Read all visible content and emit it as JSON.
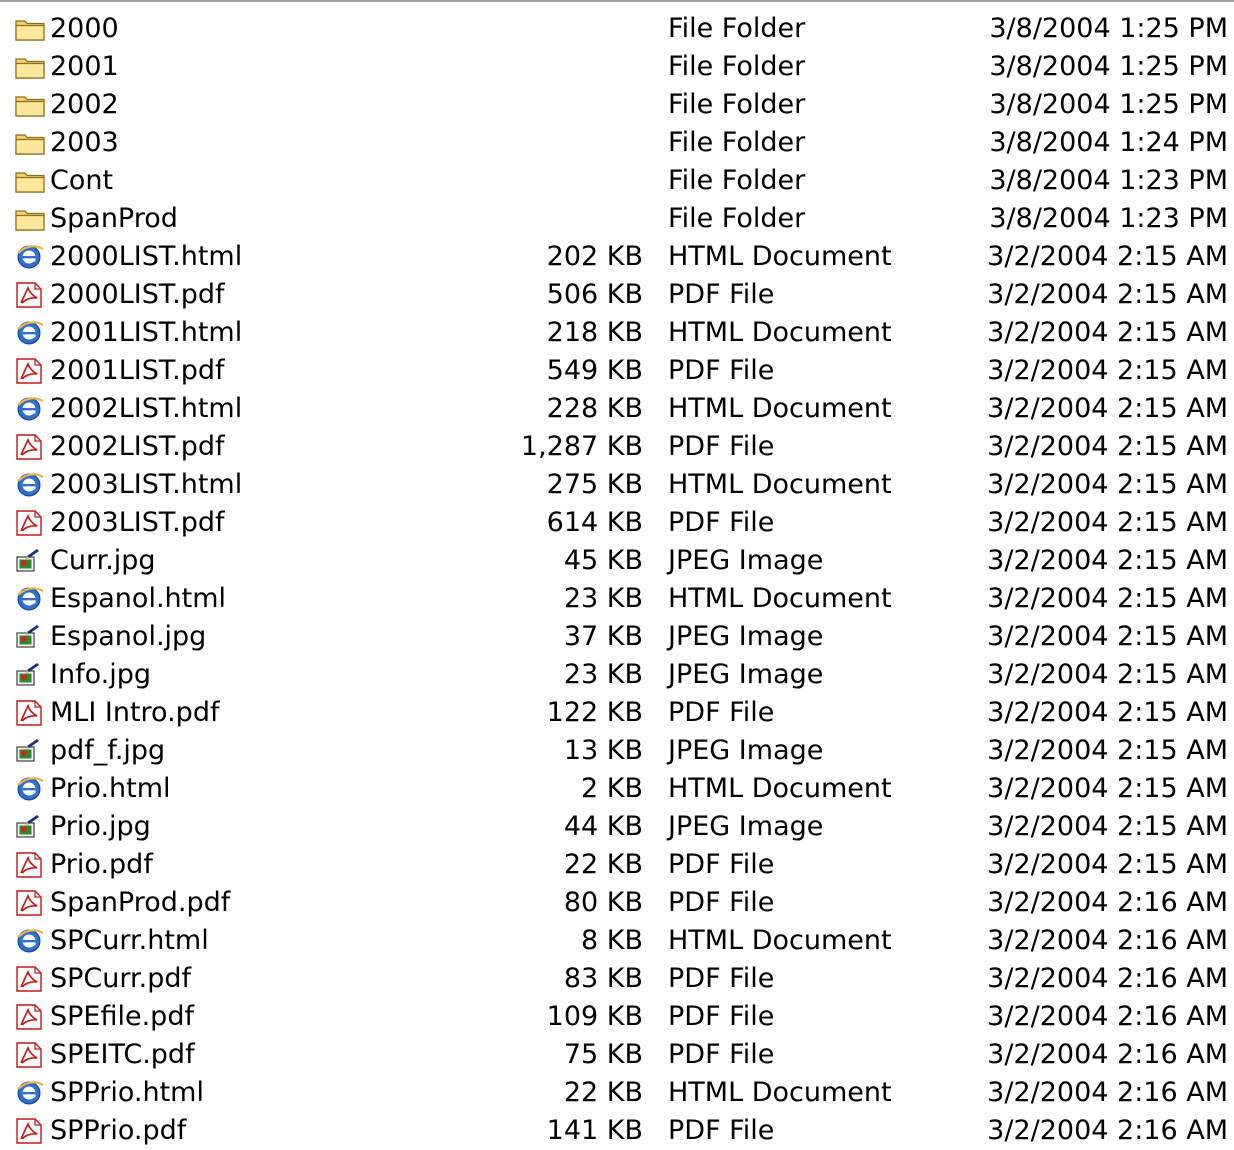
{
  "files": [
    {
      "name": "2000",
      "size": "",
      "type": "File Folder",
      "modified": "3/8/2004 1:25 PM",
      "icon": "folder-icon"
    },
    {
      "name": "2001",
      "size": "",
      "type": "File Folder",
      "modified": "3/8/2004 1:25 PM",
      "icon": "folder-icon"
    },
    {
      "name": "2002",
      "size": "",
      "type": "File Folder",
      "modified": "3/8/2004 1:25 PM",
      "icon": "folder-icon"
    },
    {
      "name": "2003",
      "size": "",
      "type": "File Folder",
      "modified": "3/8/2004 1:24 PM",
      "icon": "folder-icon"
    },
    {
      "name": "Cont",
      "size": "",
      "type": "File Folder",
      "modified": "3/8/2004 1:23 PM",
      "icon": "folder-icon"
    },
    {
      "name": "SpanProd",
      "size": "",
      "type": "File Folder",
      "modified": "3/8/2004 1:23 PM",
      "icon": "folder-icon"
    },
    {
      "name": "2000LIST.html",
      "size": "202 KB",
      "type": "HTML Document",
      "modified": "3/2/2004 2:15 AM",
      "icon": "html-document-icon"
    },
    {
      "name": "2000LIST.pdf",
      "size": "506 KB",
      "type": "PDF File",
      "modified": "3/2/2004 2:15 AM",
      "icon": "pdf-file-icon"
    },
    {
      "name": "2001LIST.html",
      "size": "218 KB",
      "type": "HTML Document",
      "modified": "3/2/2004 2:15 AM",
      "icon": "html-document-icon"
    },
    {
      "name": "2001LIST.pdf",
      "size": "549 KB",
      "type": "PDF File",
      "modified": "3/2/2004 2:15 AM",
      "icon": "pdf-file-icon"
    },
    {
      "name": "2002LIST.html",
      "size": "228 KB",
      "type": "HTML Document",
      "modified": "3/2/2004 2:15 AM",
      "icon": "html-document-icon"
    },
    {
      "name": "2002LIST.pdf",
      "size": "1,287 KB",
      "type": "PDF File",
      "modified": "3/2/2004 2:15 AM",
      "icon": "pdf-file-icon"
    },
    {
      "name": "2003LIST.html",
      "size": "275 KB",
      "type": "HTML Document",
      "modified": "3/2/2004 2:15 AM",
      "icon": "html-document-icon"
    },
    {
      "name": "2003LIST.pdf",
      "size": "614 KB",
      "type": "PDF File",
      "modified": "3/2/2004 2:15 AM",
      "icon": "pdf-file-icon"
    },
    {
      "name": "Curr.jpg",
      "size": "45 KB",
      "type": "JPEG Image",
      "modified": "3/2/2004 2:15 AM",
      "icon": "jpeg-image-icon"
    },
    {
      "name": "Espanol.html",
      "size": "23 KB",
      "type": "HTML Document",
      "modified": "3/2/2004 2:15 AM",
      "icon": "html-document-icon"
    },
    {
      "name": "Espanol.jpg",
      "size": "37 KB",
      "type": "JPEG Image",
      "modified": "3/2/2004 2:15 AM",
      "icon": "jpeg-image-icon"
    },
    {
      "name": "Info.jpg",
      "size": "23 KB",
      "type": "JPEG Image",
      "modified": "3/2/2004 2:15 AM",
      "icon": "jpeg-image-icon"
    },
    {
      "name": "MLI Intro.pdf",
      "size": "122 KB",
      "type": "PDF File",
      "modified": "3/2/2004 2:15 AM",
      "icon": "pdf-file-icon"
    },
    {
      "name": "pdf_f.jpg",
      "size": "13 KB",
      "type": "JPEG Image",
      "modified": "3/2/2004 2:15 AM",
      "icon": "jpeg-image-icon"
    },
    {
      "name": "Prio.html",
      "size": "2 KB",
      "type": "HTML Document",
      "modified": "3/2/2004 2:15 AM",
      "icon": "html-document-icon"
    },
    {
      "name": "Prio.jpg",
      "size": "44 KB",
      "type": "JPEG Image",
      "modified": "3/2/2004 2:15 AM",
      "icon": "jpeg-image-icon"
    },
    {
      "name": "Prio.pdf",
      "size": "22 KB",
      "type": "PDF File",
      "modified": "3/2/2004 2:15 AM",
      "icon": "pdf-file-icon"
    },
    {
      "name": "SpanProd.pdf",
      "size": "80 KB",
      "type": "PDF File",
      "modified": "3/2/2004 2:16 AM",
      "icon": "pdf-file-icon"
    },
    {
      "name": "SPCurr.html",
      "size": "8 KB",
      "type": "HTML Document",
      "modified": "3/2/2004 2:16 AM",
      "icon": "html-document-icon"
    },
    {
      "name": "SPCurr.pdf",
      "size": "83 KB",
      "type": "PDF File",
      "modified": "3/2/2004 2:16 AM",
      "icon": "pdf-file-icon"
    },
    {
      "name": "SPEfile.pdf",
      "size": "109 KB",
      "type": "PDF File",
      "modified": "3/2/2004 2:16 AM",
      "icon": "pdf-file-icon"
    },
    {
      "name": "SPEITC.pdf",
      "size": "75 KB",
      "type": "PDF File",
      "modified": "3/2/2004 2:16 AM",
      "icon": "pdf-file-icon"
    },
    {
      "name": "SPPrio.html",
      "size": "22 KB",
      "type": "HTML Document",
      "modified": "3/2/2004 2:16 AM",
      "icon": "html-document-icon"
    },
    {
      "name": "SPPrio.pdf",
      "size": "141 KB",
      "type": "PDF File",
      "modified": "3/2/2004 2:16 AM",
      "icon": "pdf-file-icon"
    }
  ]
}
